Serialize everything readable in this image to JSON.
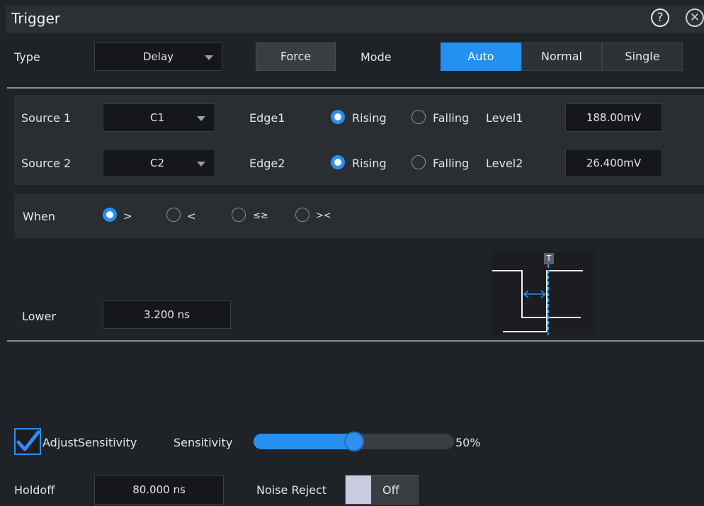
{
  "window": {
    "title": "Trigger"
  },
  "top": {
    "type_label": "Type",
    "type_value": "Delay",
    "force_label": "Force",
    "mode_label": "Mode",
    "modes": [
      "Auto",
      "Normal",
      "Single"
    ],
    "mode_selected": "Auto"
  },
  "source1": {
    "label": "Source 1",
    "value": "C1",
    "edge_label": "Edge1",
    "rising": "Rising",
    "falling": "Falling",
    "edge_selected": "Rising",
    "level_label": "Level1",
    "level_value": "188.00mV"
  },
  "source2": {
    "label": "Source 2",
    "value": "C2",
    "edge_label": "Edge2",
    "rising": "Rising",
    "falling": "Falling",
    "edge_selected": "Rising",
    "level_label": "Level2",
    "level_value": "26.400mV"
  },
  "when": {
    "label": "When",
    "options": [
      ">",
      "<",
      "≤≥",
      "><"
    ],
    "selected": ">"
  },
  "lower": {
    "label": "Lower",
    "value": "3.200 ns"
  },
  "diagram": {
    "marker": "T"
  },
  "sensitivity": {
    "adjust_label": "AdjustSensitivity",
    "adjust_checked": true,
    "label": "Sensitivity",
    "value_text": "50%",
    "value": 50
  },
  "holdoff": {
    "label": "Holdoff",
    "value": "80.000 ns"
  },
  "noise": {
    "label": "Noise Reject",
    "state": "Off"
  },
  "colors": {
    "accent": "#2490f0",
    "background": "#1f2226",
    "panel": "#2a2d31"
  },
  "icons": {
    "help": "help-icon",
    "close": "close-icon",
    "dropdown": "chevron-down-icon",
    "check": "check-icon"
  }
}
